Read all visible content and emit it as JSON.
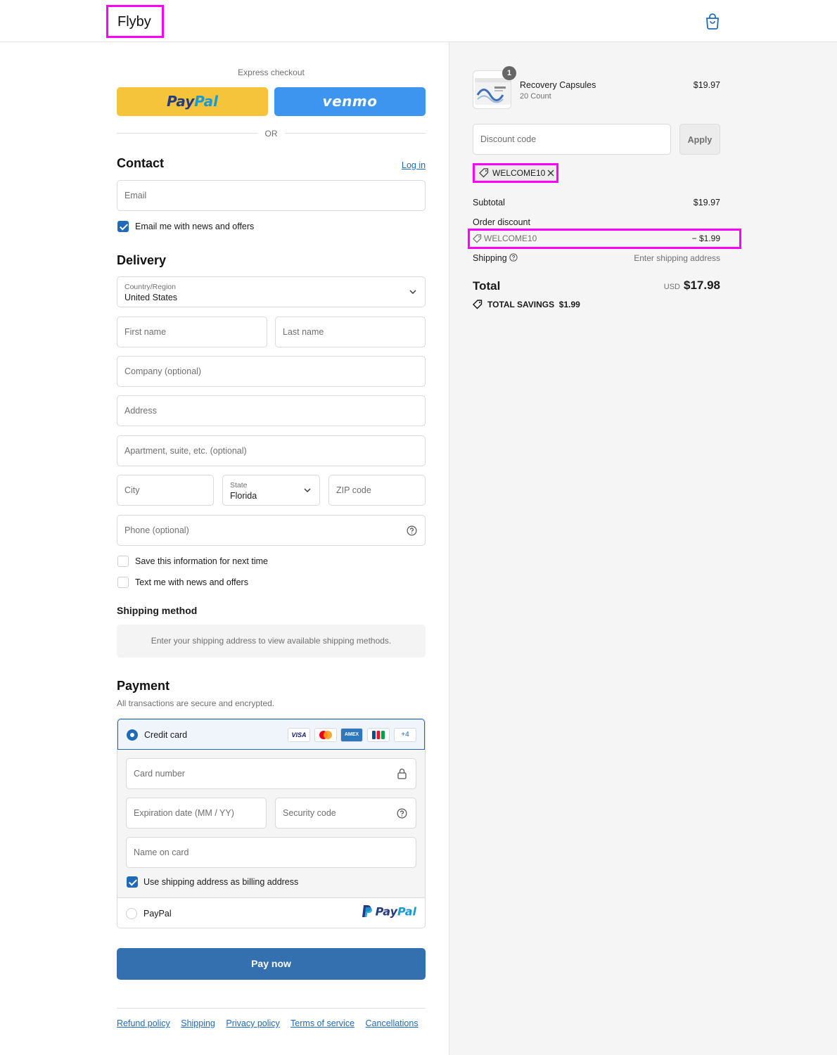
{
  "header": {
    "brand": "Flyby",
    "cart_icon": "shopping-bag-icon"
  },
  "express": {
    "title": "Express checkout",
    "paypal_part1": "Pay",
    "paypal_part2": "Pal",
    "venmo": "venmo",
    "or": "OR"
  },
  "contact": {
    "title": "Contact",
    "login": "Log in",
    "email_placeholder": "Email",
    "news_label": "Email me with news and offers",
    "news_checked": true
  },
  "delivery": {
    "title": "Delivery",
    "country_label": "Country/Region",
    "country_value": "United States",
    "first_name": "First name",
    "last_name": "Last name",
    "company": "Company (optional)",
    "address": "Address",
    "apartment": "Apartment, suite, etc. (optional)",
    "city": "City",
    "state_label": "State",
    "state_value": "Florida",
    "zip": "ZIP code",
    "phone": "Phone (optional)",
    "save_info": "Save this information for next time",
    "text_me": "Text me with news and offers"
  },
  "shipping_method": {
    "title": "Shipping method",
    "message": "Enter your shipping address to view available shipping methods."
  },
  "payment": {
    "title": "Payment",
    "subtitle": "All transactions are secure and encrypted.",
    "credit_card": "Credit card",
    "cards": [
      "VISA",
      "MC",
      "AMEX",
      "JCB",
      "+4"
    ],
    "card_number": "Card number",
    "expiration": "Expiration date (MM / YY)",
    "security_code": "Security code",
    "name_on_card": "Name on card",
    "billing_same": "Use shipping address as billing address",
    "paypal": "PayPal",
    "paypal_logo_part1": "Pay",
    "paypal_logo_part2": "Pal",
    "pay_now": "Pay now"
  },
  "footer": {
    "links": [
      "Refund policy",
      "Shipping",
      "Privacy policy",
      "Terms of service",
      "Cancellations"
    ]
  },
  "summary": {
    "item_name": "Recovery Capsules",
    "item_variant": "20 Count",
    "item_price": "$19.97",
    "item_qty": "1",
    "discount_placeholder": "Discount code",
    "apply": "Apply",
    "applied_code": "WELCOME10",
    "subtotal_label": "Subtotal",
    "subtotal_value": "$19.97",
    "order_discount_label": "Order discount",
    "discount_code": "WELCOME10",
    "discount_value": "− $1.99",
    "shipping_label": "Shipping",
    "shipping_value": "Enter shipping address",
    "total_label": "Total",
    "currency": "USD",
    "total_value": "$17.98",
    "savings_label": "TOTAL SAVINGS",
    "savings_value": "$1.99"
  },
  "colors": {
    "accent": "#1f6bb8",
    "pay_button": "#3470b0",
    "highlight": "#ff00ff",
    "paypal_yellow": "#f5c43b",
    "venmo_blue": "#3d95f0"
  }
}
